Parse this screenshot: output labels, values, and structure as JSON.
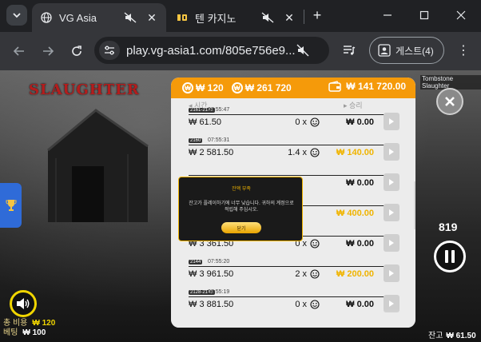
{
  "browser": {
    "tabs": [
      {
        "title": "VG Asia",
        "active": true
      },
      {
        "title": "텐 카지노",
        "active": false
      }
    ],
    "url": "play.vg-asia1.com/805e756e9...",
    "profile_label": "게스트(4)"
  },
  "game": {
    "title_tag": "Tombstone Slaughter",
    "logo_text": "SLAUGHTER",
    "header": {
      "bet_value": "₩ 120",
      "total_value": "₩ 261 720",
      "balance_value": "₩ 141 720.00"
    },
    "columns": {
      "time": "시간",
      "win": "승리"
    },
    "history": [
      {
        "tag": "2161-2181",
        "time": "07:55:47",
        "bet": "₩ 61.50",
        "mult": "0 x",
        "win": "₩ 0.00",
        "gold": false
      },
      {
        "tag": "2160",
        "time": "07:55:31",
        "bet": "₩ 2 581.50",
        "mult": "1.4 x",
        "win": "₩ 140.00",
        "gold": true
      },
      {
        "tag": "",
        "time": "",
        "bet": "",
        "mult": "",
        "win": "₩ 0.00",
        "gold": false
      },
      {
        "tag": "",
        "time": "",
        "bet": "",
        "mult": "",
        "win": "₩ 400.00",
        "gold": true
      },
      {
        "tag": "",
        "time": "",
        "bet": "₩ 3 361.50",
        "mult": "0 x",
        "win": "₩ 0.00",
        "gold": false
      },
      {
        "tag": "2144",
        "time": "07:55:20",
        "bet": "₩ 3 961.50",
        "mult": "2 x",
        "win": "₩ 200.00",
        "gold": true
      },
      {
        "tag": "2128-2143",
        "time": "07:55:19",
        "bet": "₩ 3 881.50",
        "mult": "0 x",
        "win": "₩ 0.00",
        "gold": false
      }
    ],
    "modal": {
      "title": "잔액 부족",
      "body": "잔고가 플레이하기에 너무 낮습니다. 귀하의 계정으로 적립해 주십시오.",
      "button": "닫기"
    },
    "counter": "819",
    "total_bet_label": "총 비용",
    "total_bet_value": "₩ 120",
    "bet_label": "베팅",
    "bet_value": "₩ 100",
    "balance_label": "잔고",
    "balance_value": "₩ 61.50"
  },
  "colors": {
    "accent": "#f59a0a",
    "gold": "#f0b400",
    "sound_ring": "#f0d500"
  }
}
